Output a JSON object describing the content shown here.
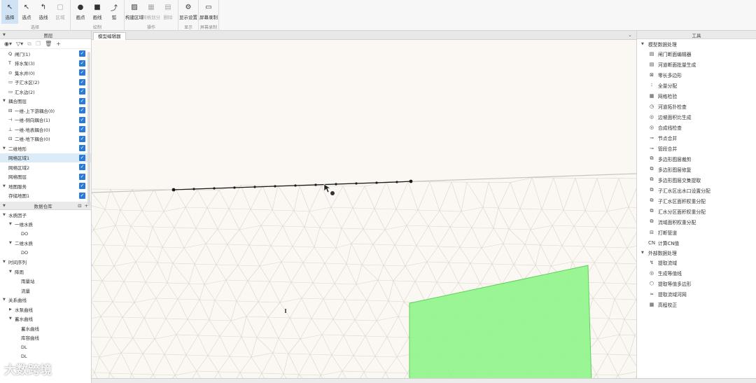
{
  "toolbar": {
    "groups": [
      {
        "label": "选择",
        "buttons": [
          {
            "label": "选择",
            "icon": "cursor-icon",
            "glyph": "↖",
            "selected": true
          },
          {
            "label": "选点",
            "icon": "point-select-icon",
            "glyph": "↖"
          },
          {
            "label": "选线",
            "icon": "line-select-icon",
            "glyph": "↰"
          },
          {
            "label": "区域",
            "icon": "area-select-icon",
            "glyph": "▢",
            "disabled": true
          }
        ]
      },
      {
        "label": "绘制",
        "buttons": [
          {
            "label": "画点",
            "icon": "dot-icon",
            "glyph": "●"
          },
          {
            "label": "画线",
            "icon": "square-icon",
            "glyph": "■"
          },
          {
            "label": "弧",
            "icon": "arc-icon",
            "glyph": "⤴"
          }
        ]
      },
      {
        "label": "操作",
        "buttons": [
          {
            "label": "构建区域",
            "icon": "hatch-icon",
            "glyph": "▨"
          },
          {
            "label": "网格划分",
            "icon": "grid-icon",
            "glyph": "▦",
            "disabled": true
          },
          {
            "label": "删除",
            "icon": "table-icon",
            "glyph": "▤",
            "disabled": true
          }
        ]
      },
      {
        "label": "显示",
        "buttons": [
          {
            "label": "显示设置",
            "icon": "gear-icon",
            "glyph": "⚙"
          }
        ]
      },
      {
        "label": "屏幕录制",
        "buttons": [
          {
            "label": "屏幕录制",
            "icon": "camera-icon",
            "glyph": "▭"
          }
        ]
      }
    ]
  },
  "left_panel": {
    "title": "图层",
    "layers": [
      {
        "label": "闸门(1)",
        "prefix": "Q",
        "checked": true
      },
      {
        "label": "排水泵(3)",
        "prefix": "T",
        "checked": true
      },
      {
        "label": "集水井(0)",
        "prefix": "⊙",
        "checked": true
      },
      {
        "label": "子汇水区(2)",
        "prefix": "▭",
        "checked": true
      },
      {
        "label": "汇水边(2)",
        "prefix": "▭",
        "checked": true
      },
      {
        "label": "耦合图层",
        "group": true,
        "checked": true
      },
      {
        "label": "一维-上下游耦合(0)",
        "prefix": "⊟",
        "checked": true
      },
      {
        "label": "一维-侧向耦合(1)",
        "prefix": "⊣",
        "checked": true
      },
      {
        "label": "一维-地表耦合(0)",
        "prefix": "⊥",
        "checked": true
      },
      {
        "label": "二维-地下耦合(0)",
        "prefix": "⊡",
        "checked": true
      },
      {
        "label": "二维地形",
        "group": true,
        "checked": true
      },
      {
        "label": "网格区域1",
        "checked": true,
        "selected": true
      },
      {
        "label": "网格区域2",
        "checked": true
      },
      {
        "label": "网格图层",
        "checked": true
      },
      {
        "label": "地图服务",
        "group": true,
        "checked": true
      },
      {
        "label": "存储地图1",
        "checked": true
      }
    ],
    "data_title": "数据仓库",
    "data_tree": [
      {
        "label": "水质因子",
        "depth": 0,
        "arrow": "▼"
      },
      {
        "label": "一维水质",
        "depth": 1,
        "arrow": "▼"
      },
      {
        "label": "DO",
        "depth": 2
      },
      {
        "label": "二维水质",
        "depth": 1,
        "arrow": "▼"
      },
      {
        "label": "DO",
        "depth": 2
      },
      {
        "label": "时间序列",
        "depth": 0,
        "arrow": "▼"
      },
      {
        "label": "降雨",
        "depth": 1,
        "arrow": "▼"
      },
      {
        "label": "雨量站",
        "depth": 2
      },
      {
        "label": "流量",
        "depth": 2
      },
      {
        "label": "关系曲线",
        "depth": 0,
        "arrow": "▼"
      },
      {
        "label": "水泵曲线",
        "depth": 1,
        "arrow": "▶"
      },
      {
        "label": "蓄水曲线",
        "depth": 1,
        "arrow": "▼"
      },
      {
        "label": "蓄水曲线",
        "depth": 2
      },
      {
        "label": "库容曲线",
        "depth": 2
      },
      {
        "label": "DL",
        "depth": 2
      },
      {
        "label": "DL",
        "depth": 2
      }
    ]
  },
  "canvas": {
    "tab_label": "模型编辑器",
    "mesh_color": "#d9d4cc",
    "polygon_color": "#8ff58a",
    "line_color": "#1a1a1a"
  },
  "right_panel": {
    "title": "工具",
    "section1": "模型数据处理",
    "tools1": [
      {
        "label": "闸门断面编辑器",
        "icon": "table-icon",
        "glyph": "▤"
      },
      {
        "label": "河道断面批量生成",
        "icon": "table-icon",
        "glyph": "▤"
      },
      {
        "label": "零长多边形",
        "icon": "close-box-icon",
        "glyph": "⊠"
      },
      {
        "label": "全量分配",
        "icon": "split-icon",
        "glyph": "⁝"
      },
      {
        "label": "网格检验",
        "icon": "grid-icon",
        "glyph": "▦"
      },
      {
        "label": "河道拓扑检查",
        "icon": "clock-icon",
        "glyph": "◷"
      },
      {
        "label": "边坡面积比生成",
        "icon": "globe-icon",
        "glyph": "◎"
      },
      {
        "label": "合成线检查",
        "icon": "globe-icon",
        "glyph": "◎"
      },
      {
        "label": "节点合并",
        "icon": "node-icon",
        "glyph": "⊸"
      },
      {
        "label": "管段合并",
        "icon": "pipe-icon",
        "glyph": "⊸"
      },
      {
        "label": "多边形图层裁剪",
        "icon": "copy-icon",
        "glyph": "⧉"
      },
      {
        "label": "多边形图层修复",
        "icon": "copy-icon",
        "glyph": "⧉"
      },
      {
        "label": "多边形图层交集提取",
        "icon": "copy-icon",
        "glyph": "⧉"
      },
      {
        "label": "子汇水区出水口设置分配",
        "icon": "copy-icon",
        "glyph": "⧉"
      },
      {
        "label": "子汇水区面积权重分配",
        "icon": "layers-icon",
        "glyph": "⧉"
      },
      {
        "label": "汇水分区面积权重分配",
        "icon": "layers-icon",
        "glyph": "⧉"
      },
      {
        "label": "流域面积权重分配",
        "icon": "layers-icon",
        "glyph": "⧉"
      },
      {
        "label": "打断管道",
        "icon": "break-icon",
        "glyph": "⊟"
      },
      {
        "label": "计算CN值",
        "icon": "cn-icon",
        "glyph": "CN"
      }
    ],
    "section2": "外部数据处理",
    "tools2": [
      {
        "label": "提取流域",
        "icon": "extract-icon",
        "glyph": "↯"
      },
      {
        "label": "生成等值线",
        "icon": "contour-icon",
        "glyph": "◎"
      },
      {
        "label": "提取等值多边形",
        "icon": "polygon-icon",
        "glyph": "⬡"
      },
      {
        "label": "提取流域河网",
        "icon": "river-icon",
        "glyph": "≈"
      },
      {
        "label": "高程校正",
        "icon": "calendar-icon",
        "glyph": "▦"
      }
    ]
  },
  "watermark": "大数跨境"
}
